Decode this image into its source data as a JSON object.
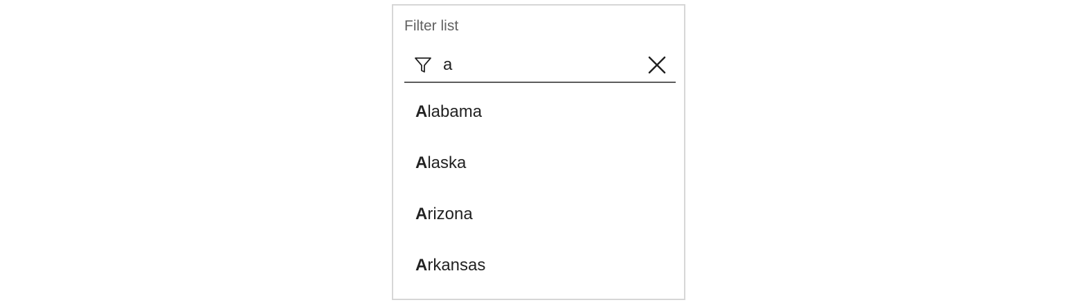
{
  "filter": {
    "label": "Filter list",
    "value": "a",
    "icon": "filter-icon",
    "clear_icon": "close-icon"
  },
  "results": [
    {
      "match": "A",
      "rest": "labama"
    },
    {
      "match": "A",
      "rest": "laska"
    },
    {
      "match": "A",
      "rest": "rizona"
    },
    {
      "match": "A",
      "rest": "rkansas"
    }
  ],
  "colors": {
    "border": "#d6d6d6",
    "label": "#616161",
    "text": "#222222",
    "underline": "#5a5a5a"
  }
}
